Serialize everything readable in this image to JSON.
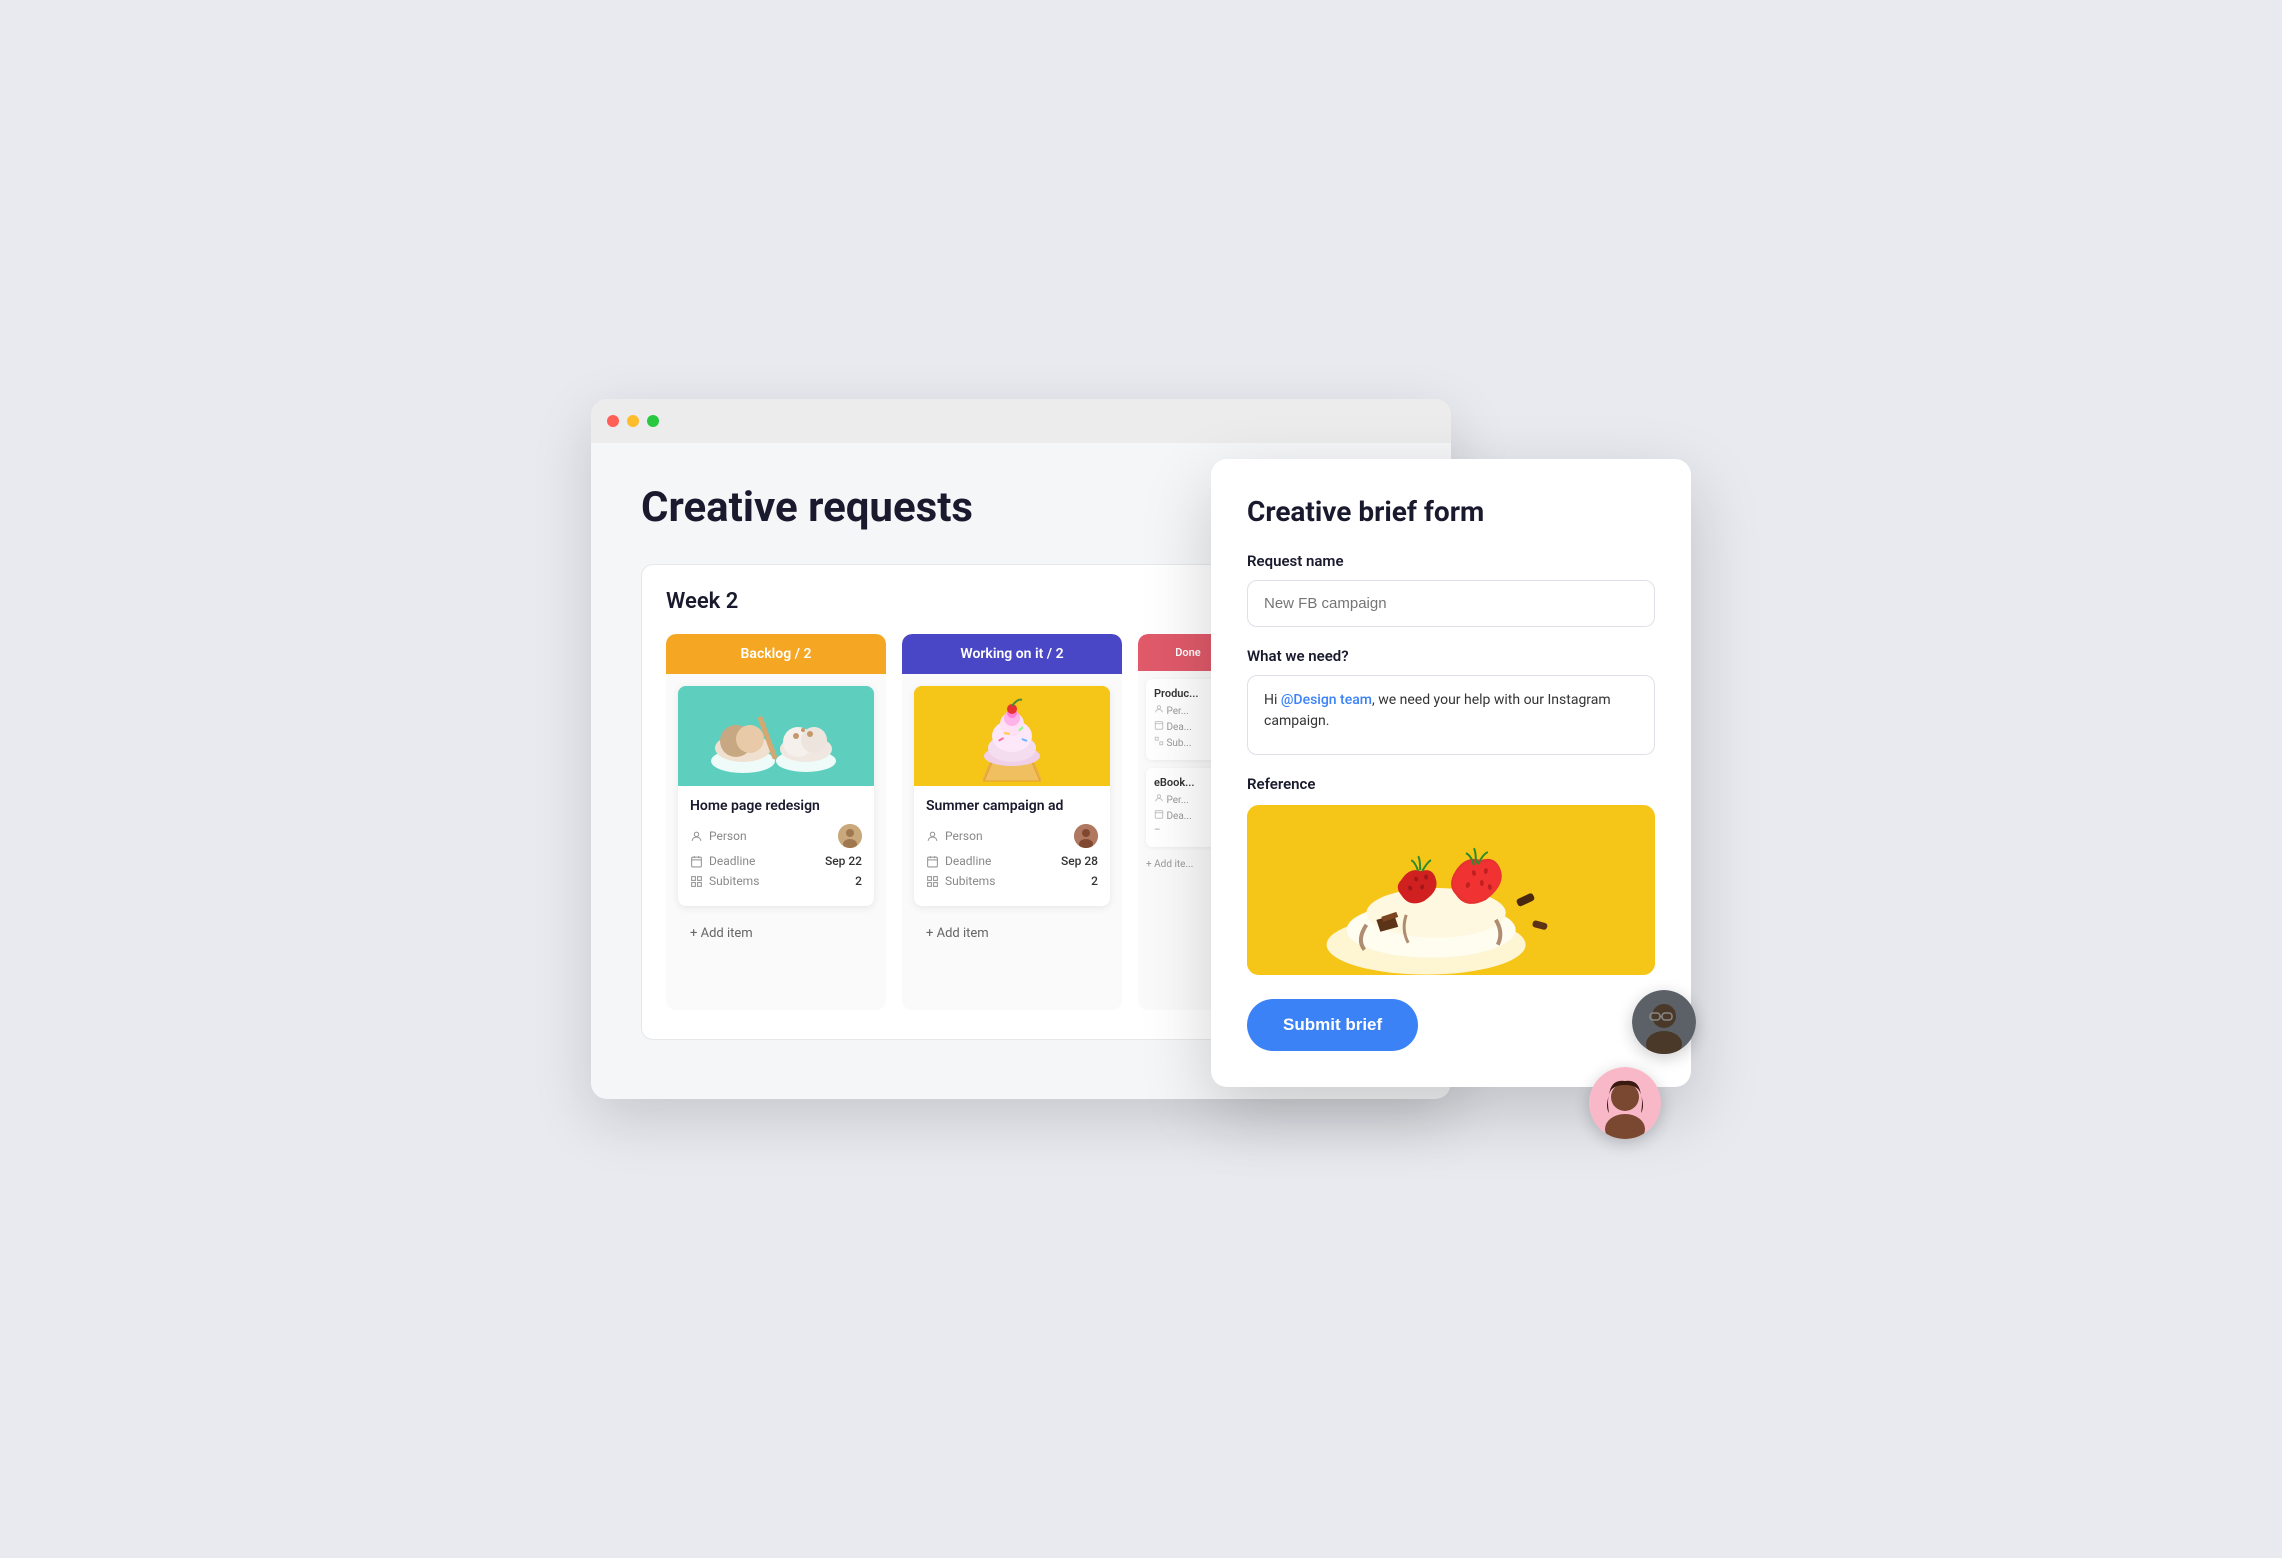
{
  "browser": {
    "traffic_lights": [
      "#ff5f57",
      "#ffbd2e",
      "#28c840"
    ]
  },
  "page": {
    "title": "Creative requests",
    "board": {
      "week_label": "Week 2",
      "columns": [
        {
          "id": "backlog",
          "label": "Backlog",
          "count": 2,
          "color": "backlog",
          "card": {
            "title": "Home page redesign",
            "person_label": "Person",
            "deadline_label": "Deadline",
            "deadline_value": "Sep 22",
            "subitems_label": "Subitems",
            "subitems_value": "2"
          },
          "add_label": "+ Add item"
        },
        {
          "id": "working",
          "label": "Working on it",
          "count": 2,
          "color": "working",
          "card": {
            "title": "Summer campaign ad",
            "person_label": "Person",
            "deadline_label": "Deadline",
            "deadline_value": "Sep 28",
            "subitems_label": "Subitems",
            "subitems_value": "2"
          },
          "add_label": "+ Add item"
        },
        {
          "id": "done",
          "label": "Done",
          "count": "",
          "color": "done",
          "cards": [
            {
              "title": "Produc...",
              "fields": [
                "Per...",
                "Dea...",
                "Sub..."
              ]
            },
            {
              "title": "eBook...",
              "fields": [
                "Per...",
                "Dea...",
                "–"
              ]
            }
          ],
          "add_label": "+ Add ite..."
        }
      ]
    }
  },
  "form": {
    "title": "Creative brief form",
    "request_name_label": "Request name",
    "request_name_placeholder": "New FB campaign",
    "what_we_need_label": "What we need?",
    "what_we_need_text_prefix": "Hi ",
    "mention": "@Design team",
    "what_we_need_text_suffix": ", we need your help with our Instagram campaign.",
    "reference_label": "Reference",
    "submit_label": "Submit brief"
  },
  "avatars": [
    {
      "id": "avatar1",
      "bg": "#6b7280",
      "initials": "👤"
    },
    {
      "id": "avatar2",
      "bg": "#f9a8d4",
      "initials": "👤"
    }
  ]
}
